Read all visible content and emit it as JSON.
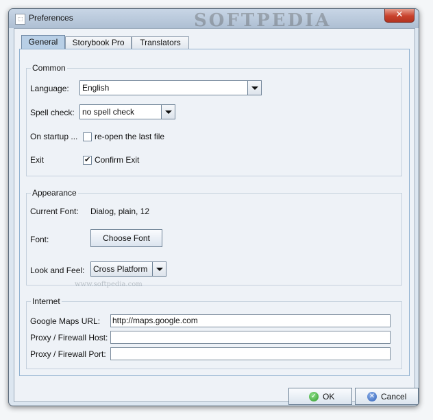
{
  "window": {
    "title": "Preferences",
    "watermark": "SOFTPEDIA",
    "close_glyph": "✕"
  },
  "tabs": [
    {
      "label": "General",
      "active": true
    },
    {
      "label": "Storybook Pro",
      "active": false
    },
    {
      "label": "Translators",
      "active": false
    }
  ],
  "common": {
    "title": "Common",
    "language_label": "Language:",
    "language_value": "English",
    "spell_label": "Spell check:",
    "spell_value": "no spell check",
    "startup_label": "On startup ...",
    "startup_option": "re-open the last file",
    "startup_checked": false,
    "exit_label": "Exit",
    "exit_option": "Confirm Exit",
    "exit_checked": true
  },
  "appearance": {
    "title": "Appearance",
    "current_font_label": "Current Font:",
    "current_font_value": "Dialog, plain, 12",
    "font_label": "Font:",
    "choose_font_button": "Choose Font",
    "laf_label": "Look and Feel:",
    "laf_value": "Cross Platform",
    "watermark_text": "www.softpedia.com"
  },
  "internet": {
    "title": "Internet",
    "maps_label": "Google Maps URL:",
    "maps_value": "http://maps.google.com",
    "proxy_host_label": "Proxy / Firewall Host:",
    "proxy_host_value": "",
    "proxy_port_label": "Proxy / Firewall Port:",
    "proxy_port_value": ""
  },
  "buttons": {
    "ok_label": "OK",
    "cancel_label": "Cancel"
  },
  "icons": {
    "ok_icon": "check-circle-icon",
    "cancel_icon": "x-circle-icon",
    "app_icon": "document-icon"
  }
}
